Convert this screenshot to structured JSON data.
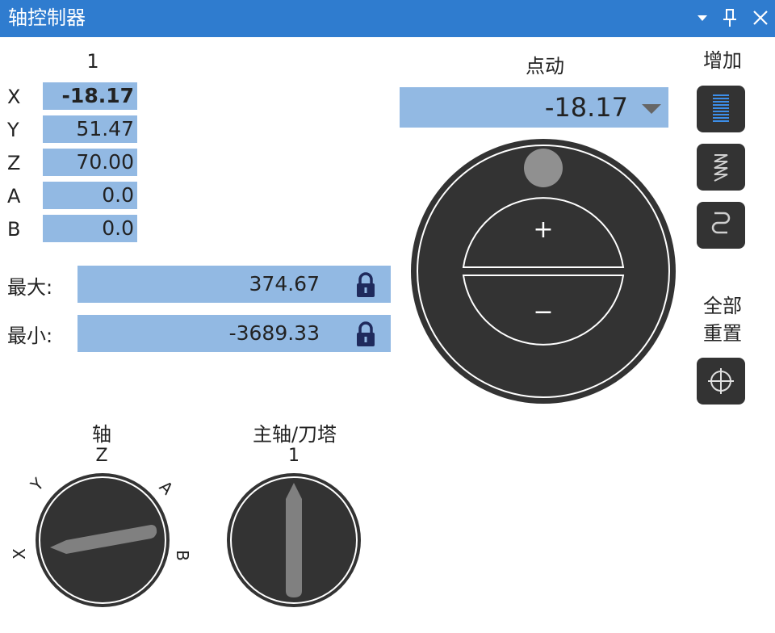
{
  "window": {
    "title": "轴控制器"
  },
  "coords": {
    "column_header": "1",
    "rows": [
      {
        "axis": "X",
        "value": "-18.17",
        "active": true
      },
      {
        "axis": "Y",
        "value": "51.47"
      },
      {
        "axis": "Z",
        "value": "70.00"
      },
      {
        "axis": "A",
        "value": "0.0"
      },
      {
        "axis": "B",
        "value": "0.0"
      }
    ]
  },
  "limits": {
    "max_label": "最大:",
    "max_value": "374.67",
    "min_label": "最小:",
    "min_value": "-3689.33"
  },
  "jog": {
    "title": "点动",
    "value": "-18.17",
    "plus": "+",
    "minus": "−"
  },
  "increment": {
    "title": "增加"
  },
  "reset": {
    "title_line1": "全部",
    "title_line2": "重置"
  },
  "axis_knob": {
    "title": "轴",
    "current": "Z",
    "ticks": [
      "X",
      "Y",
      "A",
      "B"
    ]
  },
  "spindle_knob": {
    "title": "主轴/刀塔",
    "current": "1"
  },
  "colors": {
    "titlebar": "#2f7ccf",
    "field": "#92b9e3",
    "control_dark": "#333333",
    "lock": "#1f2a5c"
  }
}
